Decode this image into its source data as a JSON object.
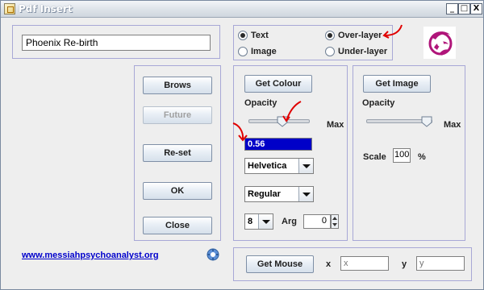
{
  "window": {
    "title": "Pdf Insert",
    "min_glyph": "_",
    "max_glyph": "□",
    "close_glyph": "X"
  },
  "text_field": {
    "value": "Phoenix Re-birth"
  },
  "mode": {
    "text_label": "Text",
    "image_label": "Image",
    "over_label": "Over-layer",
    "under_label": "Under-layer",
    "selected_type": "Text",
    "selected_layer": "Over-layer"
  },
  "left_buttons": {
    "browse": "Brows",
    "future": "Future",
    "reset": "Re-set",
    "ok": "OK",
    "close": "Close"
  },
  "text_panel": {
    "get_colour": "Get Colour",
    "opacity_label": "Opacity",
    "max_label": "Max",
    "opacity_fraction": 0.56,
    "opacity_value": "0.56",
    "font_name": "Helvetica",
    "font_style": "Regular",
    "font_size": "8",
    "arg_label": "Arg",
    "arg_value": "0"
  },
  "image_panel": {
    "get_image": "Get Image",
    "opacity_label": "Opacity",
    "max_label": "Max",
    "opacity_fraction": 1.0,
    "scale_label": "Scale",
    "scale_value": "100",
    "percent": "%"
  },
  "mouse_panel": {
    "get_mouse": "Get Mouse",
    "x_label": "x",
    "x_placeholder": "x",
    "y_label": "y",
    "y_placeholder": "y"
  },
  "footer": {
    "link": "www.messiahpsychoanalyst.org"
  },
  "colors": {
    "panel_border": "#a8a8d6",
    "selection": "#0000c8",
    "annotation": "#e00000",
    "logo": "#b0157a"
  },
  "icons": [
    "app-icon",
    "phoenix-logo-icon",
    "help-gear-icon",
    "red-arrow-annotation",
    "red-check-annotation"
  ]
}
